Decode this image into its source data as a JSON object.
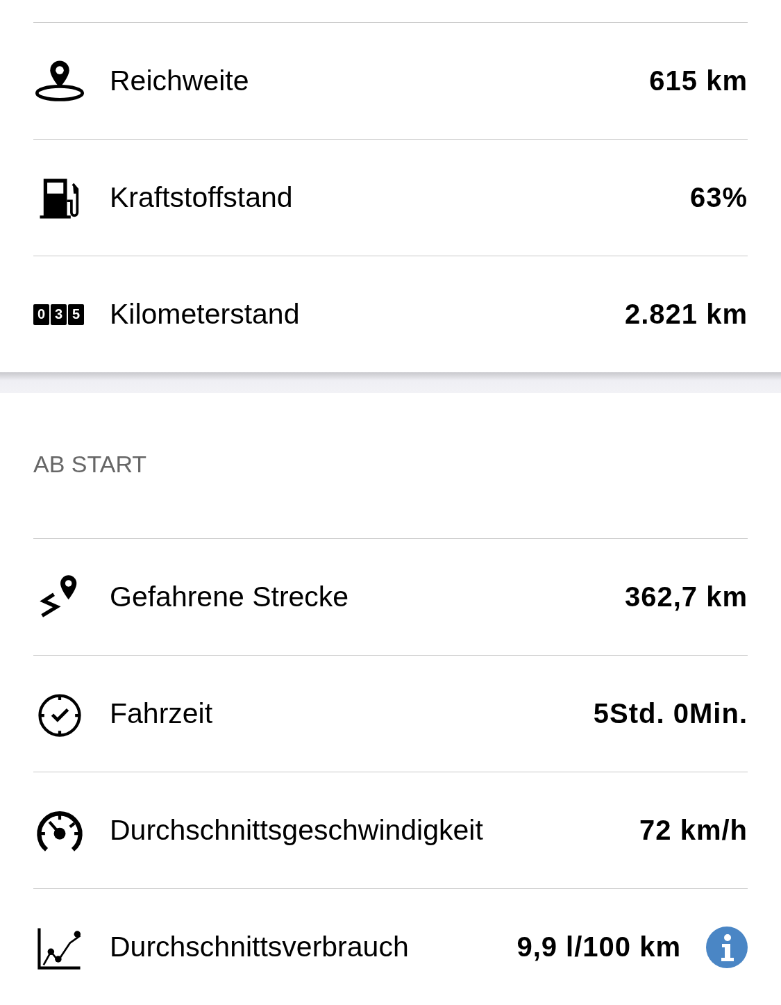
{
  "vehicle_status": [
    {
      "label": "Reichweite",
      "value": "615 km"
    },
    {
      "label": "Kraftstoffstand",
      "value": "63%"
    },
    {
      "odometer_digits": [
        "0",
        "3",
        "5"
      ],
      "label": "Kilometerstand",
      "value": "2.821 km"
    }
  ],
  "since_start": {
    "title": "AB START",
    "rows": [
      {
        "label": "Gefahrene Strecke",
        "value": "362,7 km"
      },
      {
        "label": "Fahrzeit",
        "value": "5Std. 0Min."
      },
      {
        "label": "Durchschnittsgeschwindigkeit",
        "value": "72 km/h"
      },
      {
        "label": "Durchschnittsverbrauch",
        "value": "9,9 l/100 km"
      }
    ]
  }
}
